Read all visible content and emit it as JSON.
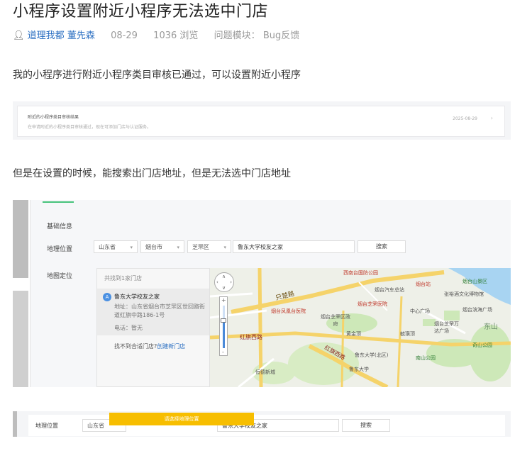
{
  "article": {
    "title": "小程序设置附近小程序无法选中门店",
    "author_group": "道理我都",
    "author": "董先森",
    "date": "08-29",
    "views": "1036 浏览",
    "module_label": "问题模块：",
    "module_value": "Bug反馈",
    "paragraph1": "我的小程序进行附近小程序类目审核已通过，可以设置附近小程序",
    "paragraph2": "但是在设置的时候，能搜索出门店地址，但是无法选中门店地址"
  },
  "shot1": {
    "title": "附近的小程序类目审核结果",
    "subtitle": "在申请附近的小程序类目审核通过，现在可添加门店与认证服务。",
    "date": "2025-08-29"
  },
  "shot2": {
    "section": "基础信息",
    "location_label": "地理位置",
    "map_label": "地图定位",
    "province": "山东省",
    "city": "烟台市",
    "district": "芝罘区",
    "search_value": "鲁东大学校友之家",
    "search_button": "搜索",
    "found_count": "共找到1家门店",
    "result_index": "A",
    "result_name": "鲁东大学校友之家",
    "result_address": "地址：山东省烟台市芝罘区世回路街道红旗中路186-1号",
    "result_phone": "电话：暂无",
    "not_found_text": "找不到合适门店?",
    "create_link": "创建新门店",
    "map_places": {
      "p1": "西南台国防公园",
      "p2": "烟台山景区",
      "p3": "烟台站",
      "p4": "烟台汽车总站",
      "p5": "张裕酒文化博物馆",
      "p6": "只楚路",
      "p7": "烟台芝罘医院",
      "p8": "中心广场",
      "p9": "烟台滨海广场",
      "p10": "烟台凤凰台医院",
      "p11": "烟台芝罘区政府",
      "p12": "烟台芝罘万达广场",
      "p13": "东山",
      "p14": "黄金顶",
      "p15": "奇山公园",
      "p16": "世回路",
      "p17": "红旗西路",
      "p18": "鲁东大学(北区)",
      "p19": "南山公园",
      "p20": "鲁东大学",
      "p21": "恒德新城",
      "p22": "红旗西路",
      "p23": "烟台东站",
      "p24": "烟台山",
      "p25": "毓璜顶",
      "p26": "青年南路"
    }
  },
  "shot3": {
    "location_label": "地理位置",
    "province": "山东省",
    "toast": "请选择地理位置",
    "search_value": "鲁东大学校友之家",
    "search_button": "搜索"
  }
}
